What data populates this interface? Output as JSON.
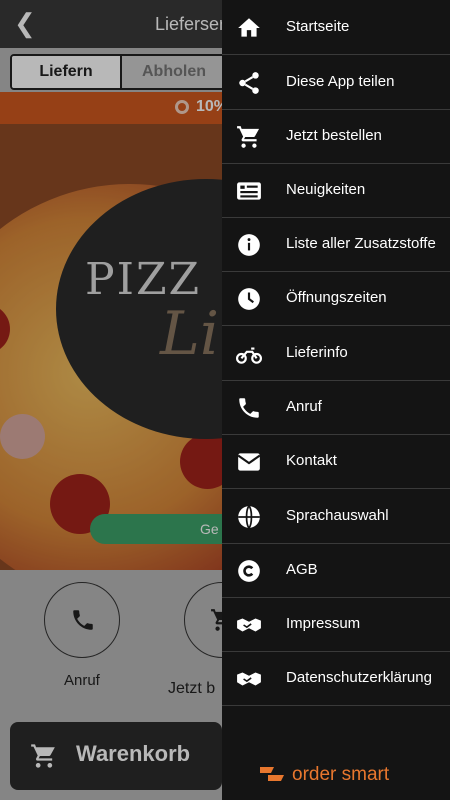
{
  "header": {
    "back_icon": "chevron-left-icon",
    "title": "Lieferser"
  },
  "order_mode": {
    "options": [
      "Liefern",
      "Abholen"
    ],
    "selected": "Liefern"
  },
  "promo": {
    "text": "10%",
    "icon": "badge-icon"
  },
  "hero": {
    "logo_text": "PIZZ",
    "logo_script": "Li",
    "button_label": "Ge"
  },
  "quick_actions": [
    {
      "label": "Anruf",
      "icon": "phone-icon"
    },
    {
      "label": "Jetzt b",
      "icon": "cart-icon"
    }
  ],
  "cart": {
    "label": "Warenkorb",
    "icon": "cart-icon"
  },
  "drawer": {
    "items": [
      {
        "label": "Startseite",
        "icon": "home-icon"
      },
      {
        "label": "Diese App teilen",
        "icon": "share-icon"
      },
      {
        "label": "Jetzt bestellen",
        "icon": "cart-icon"
      },
      {
        "label": "Neuigkeiten",
        "icon": "news-icon"
      },
      {
        "label": "Liste aller Zusatzstoffe",
        "icon": "info-icon"
      },
      {
        "label": "Öffnungszeiten",
        "icon": "clock-icon"
      },
      {
        "label": "Lieferinfo",
        "icon": "motorcycle-icon"
      },
      {
        "label": "Anruf",
        "icon": "phone-icon"
      },
      {
        "label": "Kontakt",
        "icon": "mail-icon"
      },
      {
        "label": "Sprachauswahl",
        "icon": "globe-icon"
      },
      {
        "label": "AGB",
        "icon": "copyright-icon"
      },
      {
        "label": "Impressum",
        "icon": "handshake-icon"
      },
      {
        "label": "Datenschutzerklärung",
        "icon": "handshake-icon"
      }
    ],
    "brand": "order smart",
    "brand_color": "#e8772e"
  }
}
